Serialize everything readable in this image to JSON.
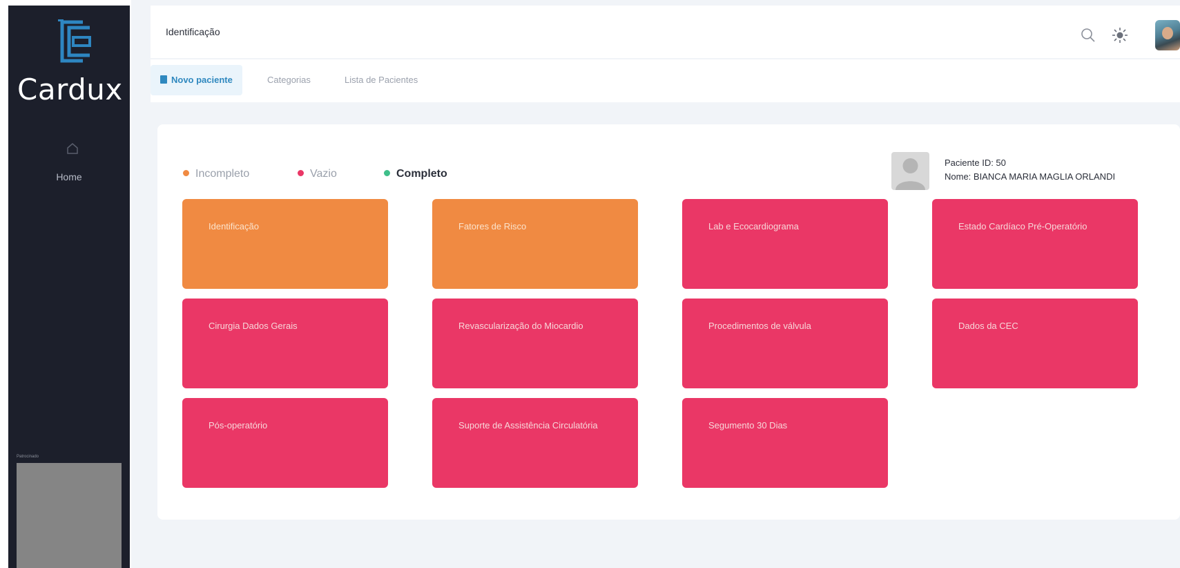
{
  "app": {
    "brand": "Cardux",
    "nav": [
      {
        "label": "Home",
        "icon": "home-icon"
      }
    ],
    "thumbnail_caption": "Patrocinado"
  },
  "header": {
    "title": "Identificação",
    "icons": [
      "search-icon",
      "sun-icon",
      "user-avatar"
    ]
  },
  "tabs": [
    {
      "label": "Novo paciente",
      "active": true,
      "icon": "document-icon"
    },
    {
      "label": "Categorias",
      "active": false
    },
    {
      "label": "Lista de Pacientes",
      "active": false
    }
  ],
  "legend": [
    {
      "label": "Incompleto",
      "color": "#f08a42"
    },
    {
      "label": "Vazio",
      "color": "#ea3766"
    },
    {
      "label": "Completo",
      "color": "#3fbf8a"
    }
  ],
  "patient": {
    "id_text": "Paciente ID: 50",
    "name_text": "Nome: BIANCA MARIA MAGLIA ORLANDI"
  },
  "categories": [
    {
      "label": "Identificação",
      "status": "Incompleto"
    },
    {
      "label": "Fatores de Risco",
      "status": "Incompleto"
    },
    {
      "label": "Lab e Ecocardiograma",
      "status": "Vazio"
    },
    {
      "label": "Estado Cardíaco Pré-Operatório",
      "status": "Vazio"
    },
    {
      "label": "Cirurgia Dados Gerais",
      "status": "Vazio"
    },
    {
      "label": "Revascularização do Miocardio",
      "status": "Vazio"
    },
    {
      "label": "Procedimentos de válvula",
      "status": "Vazio"
    },
    {
      "label": "Dados da CEC",
      "status": "Vazio"
    },
    {
      "label": "Pós-operatório",
      "status": "Vazio"
    },
    {
      "label": "Suporte de Assistência Circulatória",
      "status": "Vazio"
    },
    {
      "label": "Segumento 30 Dias",
      "status": "Vazio"
    }
  ]
}
